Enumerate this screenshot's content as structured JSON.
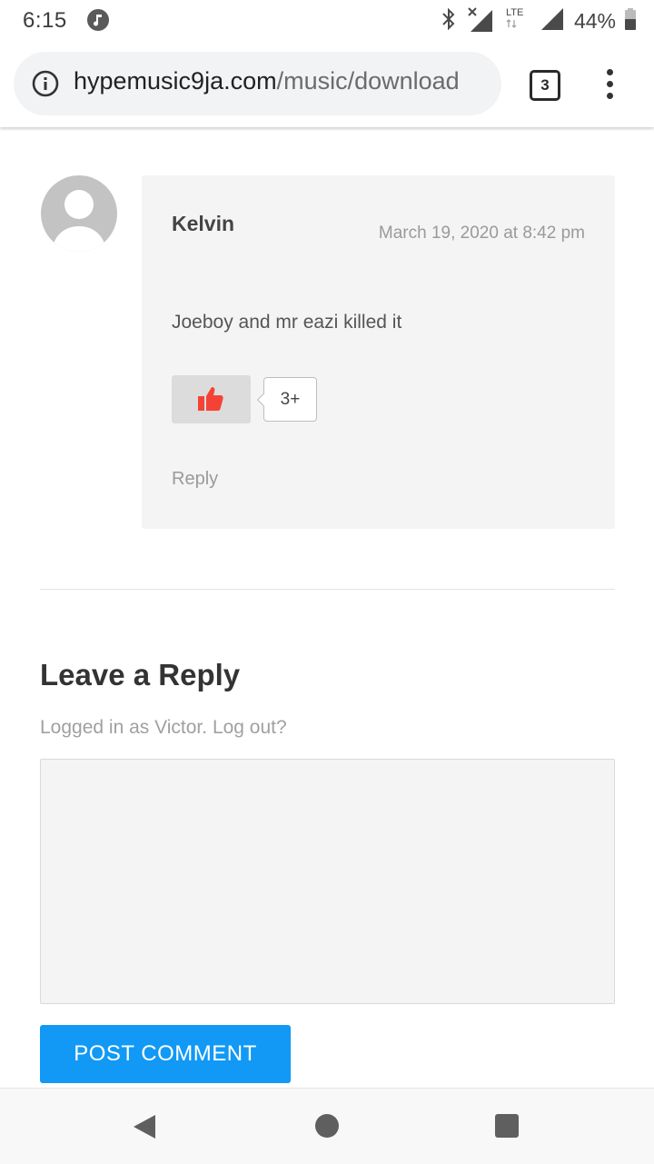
{
  "status_bar": {
    "time": "6:15",
    "battery": "44%",
    "network": "LTE",
    "icons": [
      "music-note-icon",
      "bluetooth-icon",
      "signal-no-data-icon",
      "lte-signal-icon",
      "battery-icon"
    ]
  },
  "browser": {
    "url_domain": "hypemusic9ja.com",
    "url_path": "/music/download",
    "tab_count": "3"
  },
  "comment": {
    "author": "Kelvin",
    "date": "March 19, 2020 at 8:42 pm",
    "text": "Joeboy and mr eazi killed it",
    "likes": "3+",
    "reply_label": "Reply"
  },
  "reply_form": {
    "title": "Leave a Reply",
    "logged_in_prefix": "Logged in as ",
    "user": "Victor",
    "separator": ". ",
    "logout": "Log out?",
    "comment_value": "",
    "submit_label": "POST COMMENT"
  },
  "colors": {
    "accent": "#1199f5",
    "like_icon": "#f44336",
    "comment_bg": "#f4f4f4"
  }
}
